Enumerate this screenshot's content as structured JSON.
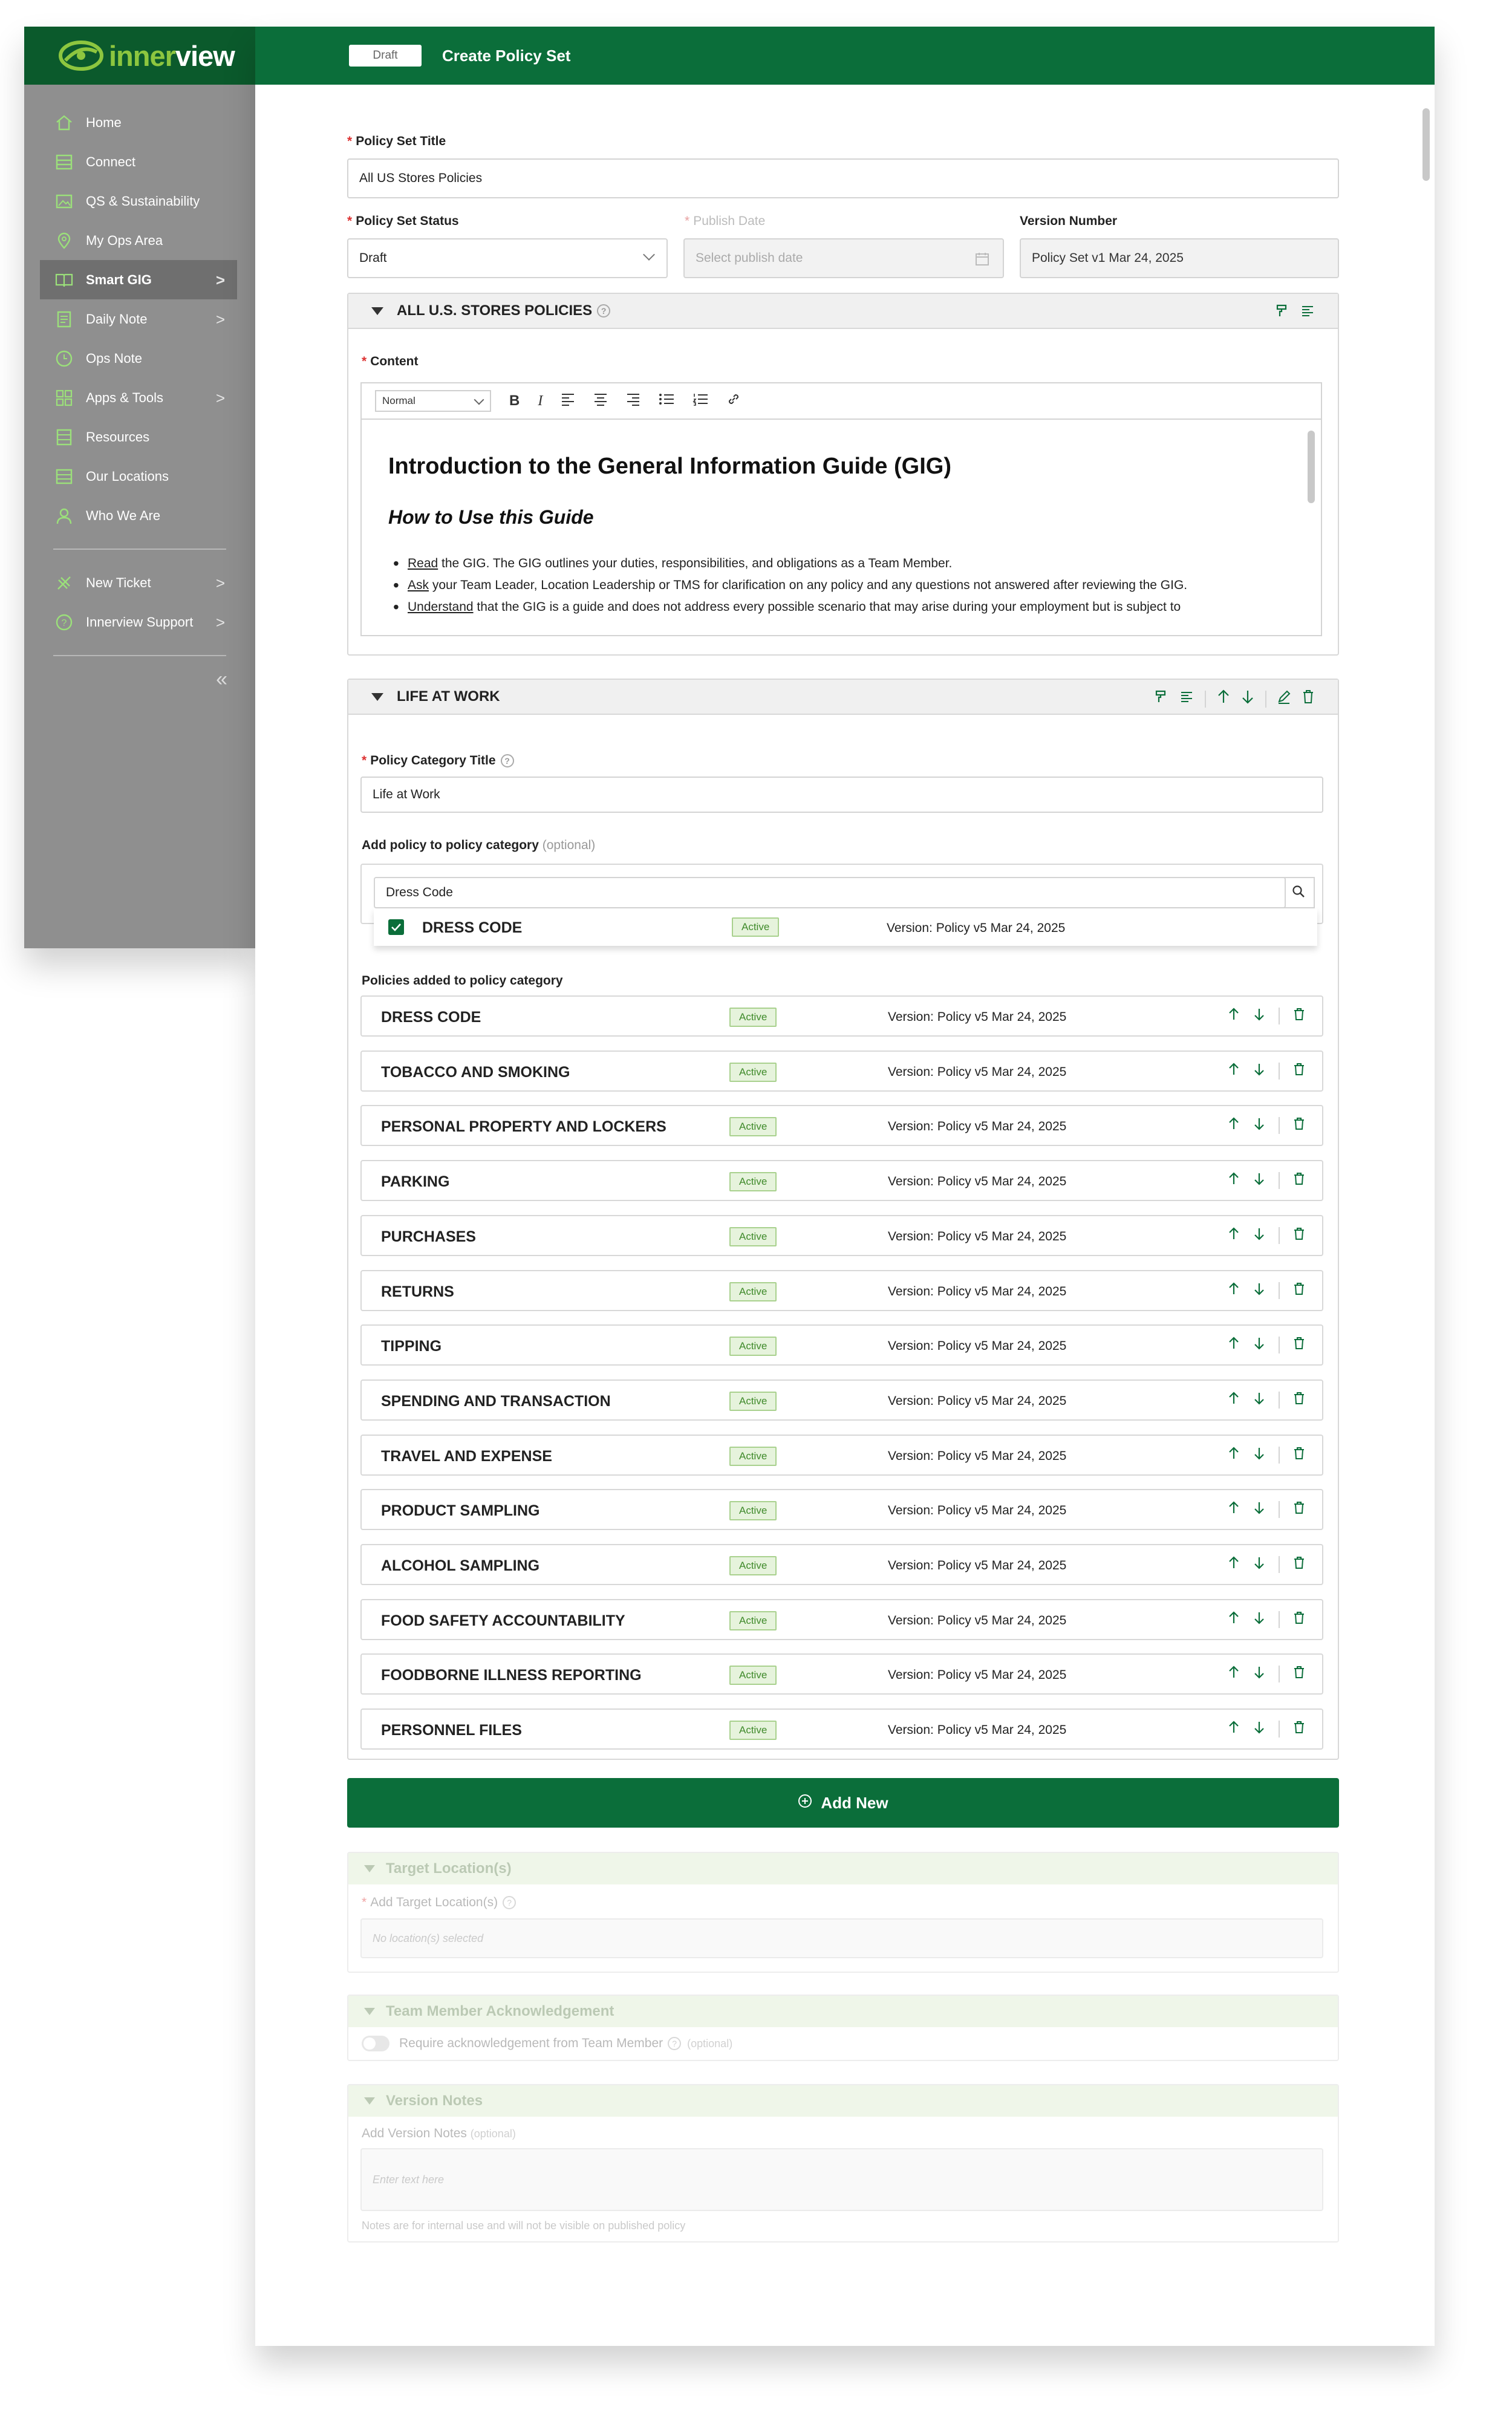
{
  "brand": {
    "logo_text_a": "inner",
    "logo_text_b": "view"
  },
  "sidebar": {
    "items": [
      {
        "label": "Home",
        "icon": "home-icon"
      },
      {
        "label": "Connect",
        "icon": "connect-icon"
      },
      {
        "label": "QS & Sustainability",
        "icon": "image-icon"
      },
      {
        "label": "My Ops Area",
        "icon": "location-pin-icon"
      },
      {
        "label": "Smart GIG",
        "icon": "book-icon",
        "active": true,
        "chevron": ">"
      },
      {
        "label": "Daily Note",
        "icon": "note-icon",
        "chevron": ">"
      },
      {
        "label": "Ops Note",
        "icon": "clock-icon"
      },
      {
        "label": "Apps & Tools",
        "icon": "apps-icon",
        "chevron": ">"
      },
      {
        "label": "Resources",
        "icon": "list-icon"
      },
      {
        "label": "Our Locations",
        "icon": "store-icon"
      },
      {
        "label": "Who We Are",
        "icon": "user-icon"
      }
    ],
    "bottom_items": [
      {
        "label": "New Ticket",
        "icon": "ticket-icon",
        "chevron": ">"
      },
      {
        "label": "Innerview Support",
        "icon": "help-icon",
        "chevron": ">"
      }
    ],
    "collapse": "«"
  },
  "header": {
    "status_pill": "Draft",
    "title": "Create Policy Set"
  },
  "form": {
    "policy_set_title_label": "Policy Set Title",
    "policy_set_title_value": "All US Stores Policies",
    "status_label": "Policy Set Status",
    "status_value": "Draft",
    "publish_date_label": "Publish Date",
    "publish_date_placeholder": "Select publish date",
    "version_label": "Version Number",
    "version_value": "Policy Set v1 Mar 24, 2025"
  },
  "section1": {
    "title": "ALL U.S. STORES POLICIES",
    "content_label": "Content",
    "toolbar_select": "Normal",
    "heading1": "Introduction to the General Information Guide (GIG)",
    "heading2": "How to Use this Guide",
    "bullets": [
      {
        "u": "Read",
        "rest": " the GIG. The GIG outlines your duties, responsibilities, and obligations as a Team Member."
      },
      {
        "u": "Ask",
        "rest": " your Team Leader, Location Leadership or TMS for clarification on any policy and any questions not answered after reviewing the GIG."
      },
      {
        "u": "Understand",
        "rest": " that the GIG is a guide and does not address every possible scenario that may arise during your employment but is subject to"
      }
    ]
  },
  "section2": {
    "title": "LIFE AT WORK",
    "category_title_label": "Policy Category Title",
    "category_title_value": "Life at Work",
    "add_policy_label": "Add policy to policy category",
    "optional": "(optional)",
    "search_value": "Dress Code",
    "search_result": {
      "name": "DRESS CODE",
      "status": "Active",
      "version": "Version: Policy v5 Mar 24, 2025"
    },
    "added_label": "Policies added to policy category",
    "policies": [
      {
        "name": "DRESS CODE",
        "status": "Active",
        "version": "Version: Policy v5 Mar 24, 2025"
      },
      {
        "name": "TOBACCO AND SMOKING",
        "status": "Active",
        "version": "Version: Policy v5 Mar 24, 2025"
      },
      {
        "name": "PERSONAL PROPERTY AND LOCKERS",
        "status": "Active",
        "version": "Version: Policy v5 Mar 24, 2025"
      },
      {
        "name": "PARKING",
        "status": "Active",
        "version": "Version: Policy v5 Mar 24, 2025"
      },
      {
        "name": "PURCHASES",
        "status": "Active",
        "version": "Version: Policy v5 Mar 24, 2025"
      },
      {
        "name": "RETURNS",
        "status": "Active",
        "version": "Version: Policy v5 Mar 24, 2025"
      },
      {
        "name": "TIPPING",
        "status": "Active",
        "version": "Version: Policy v5 Mar 24, 2025"
      },
      {
        "name": "SPENDING AND TRANSACTION",
        "status": "Active",
        "version": "Version: Policy v5 Mar 24, 2025"
      },
      {
        "name": "TRAVEL AND EXPENSE",
        "status": "Active",
        "version": "Version: Policy v5 Mar 24, 2025"
      },
      {
        "name": "PRODUCT SAMPLING",
        "status": "Active",
        "version": "Version: Policy v5 Mar 24, 2025"
      },
      {
        "name": "ALCOHOL SAMPLING",
        "status": "Active",
        "version": "Version: Policy v5 Mar 24, 2025"
      },
      {
        "name": "FOOD SAFETY ACCOUNTABILITY",
        "status": "Active",
        "version": "Version: Policy v5 Mar 24, 2025"
      },
      {
        "name": "FOODBORNE ILLNESS REPORTING",
        "status": "Active",
        "version": "Version: Policy v5 Mar 24, 2025"
      },
      {
        "name": "PERSONNEL FILES",
        "status": "Active",
        "version": "Version: Policy v5 Mar 24, 2025"
      }
    ]
  },
  "add_new": "Add New",
  "target": {
    "title": "Target Location(s)",
    "label": "Add Target Location(s)",
    "placeholder": "No location(s) selected"
  },
  "ack": {
    "title": "Team Member Acknowledgement",
    "label": "Require acknowledgement from Team Member",
    "optional": "(optional)"
  },
  "notes": {
    "title": "Version Notes",
    "label": "Add Version Notes",
    "optional": "(optional)",
    "placeholder": "Enter text here",
    "hint": "Notes are for internal use and will not be visible on published policy"
  },
  "colors": {
    "brand_green": "#0b6e3a",
    "badge_green": "#3f8a2a",
    "logo_lime": "#8dc63f"
  }
}
